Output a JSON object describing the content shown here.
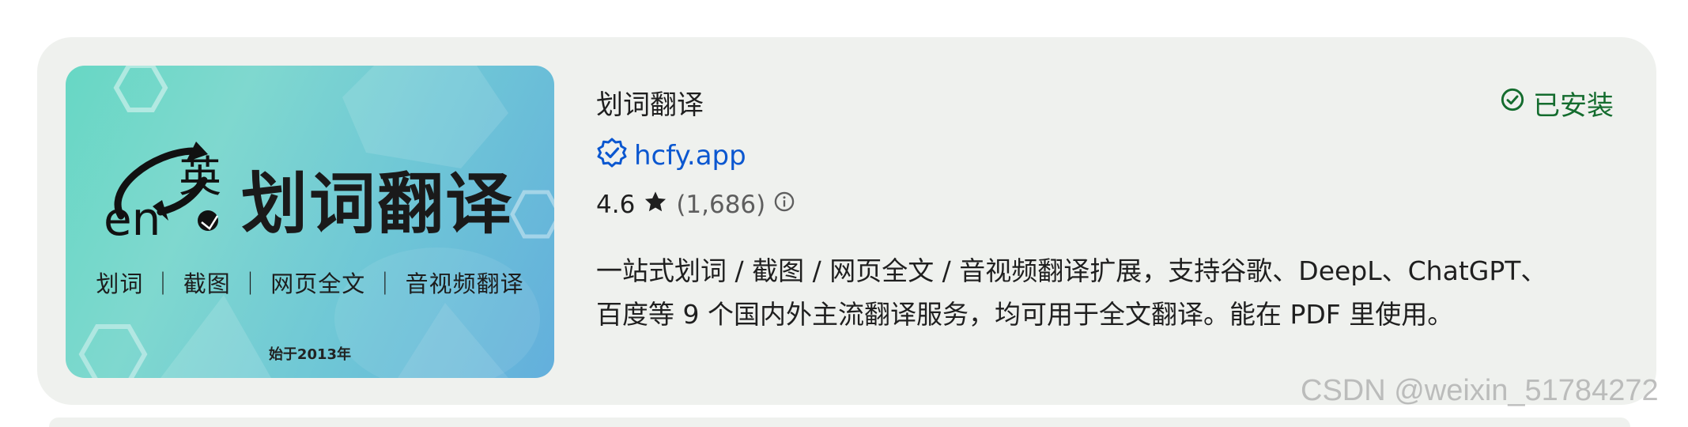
{
  "extension": {
    "name": "划词翻译",
    "publisher": "hcfy.app",
    "rating": "4.6",
    "rating_count": "(1,686)",
    "description_line1": "一站式划词 / 截图 / 网页全文 / 音视频翻译扩展，支持谷歌、DeepL、ChatGPT、",
    "description_line2": "百度等 9 个国内外主流翻译服务，均可用于全文翻译。能在 PDF 里使用。",
    "status": "已安装"
  },
  "thumbnail": {
    "title": "划词翻译",
    "en_text": "en",
    "ying_text": "英",
    "subtitle": "划词 ｜ 截图 ｜ 网页全文 ｜ 音视频翻译",
    "since": "始于2013年"
  },
  "watermark": "CSDN @weixin_51784272",
  "colors": {
    "card_background": "#eff1ee",
    "publisher_link": "#0b57d0",
    "installed_green": "#146c2e",
    "thumbnail_gradient": [
      "#67d7c4",
      "#63afdc"
    ]
  },
  "icons": {
    "verified": "verified-badge-icon",
    "star": "star-icon",
    "info": "info-icon",
    "installed": "check-circle-icon"
  }
}
